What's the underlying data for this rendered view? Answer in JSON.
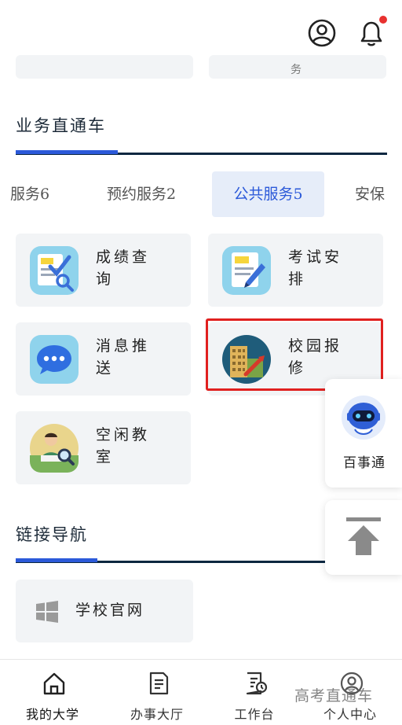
{
  "header": {
    "profile_icon": "user-circle-icon",
    "notification_icon": "bell-icon",
    "notification_dot_color": "#e8312f"
  },
  "peek_row": {
    "partial_text": "务"
  },
  "section_service": {
    "title": "业务直通车",
    "accent_color": "#2b59d9"
  },
  "tabs": [
    {
      "label": "服务6",
      "active": false
    },
    {
      "label": "预约服务2",
      "active": false
    },
    {
      "label": "公共服务5",
      "active": true
    },
    {
      "label": "安保",
      "active": false
    }
  ],
  "services": [
    {
      "label": "成绩查询",
      "icon": "grade-query-icon"
    },
    {
      "label": "考试安排",
      "icon": "exam-schedule-icon"
    },
    {
      "label": "消息推送",
      "icon": "message-push-icon"
    },
    {
      "label": "校园报修",
      "icon": "campus-repair-icon",
      "highlighted": true
    },
    {
      "label": "空闲教室",
      "icon": "free-classroom-icon"
    }
  ],
  "assistant": {
    "label": "百事通",
    "icon": "robot-icon"
  },
  "back_to_top": {
    "icon": "arrow-up-to-top-icon"
  },
  "section_links": {
    "title": "链接导航"
  },
  "links": [
    {
      "label": "学校官网",
      "icon": "windows-icon"
    }
  ],
  "bottom_nav": [
    {
      "label": "我的大学",
      "icon": "home-icon",
      "active": true
    },
    {
      "label": "办事大厅",
      "icon": "document-icon",
      "active": false
    },
    {
      "label": "工作台",
      "icon": "calendar-doc-icon",
      "active": false
    },
    {
      "label": "个人中心",
      "icon": "person-icon",
      "active": false
    }
  ],
  "watermark": "高考直通车"
}
